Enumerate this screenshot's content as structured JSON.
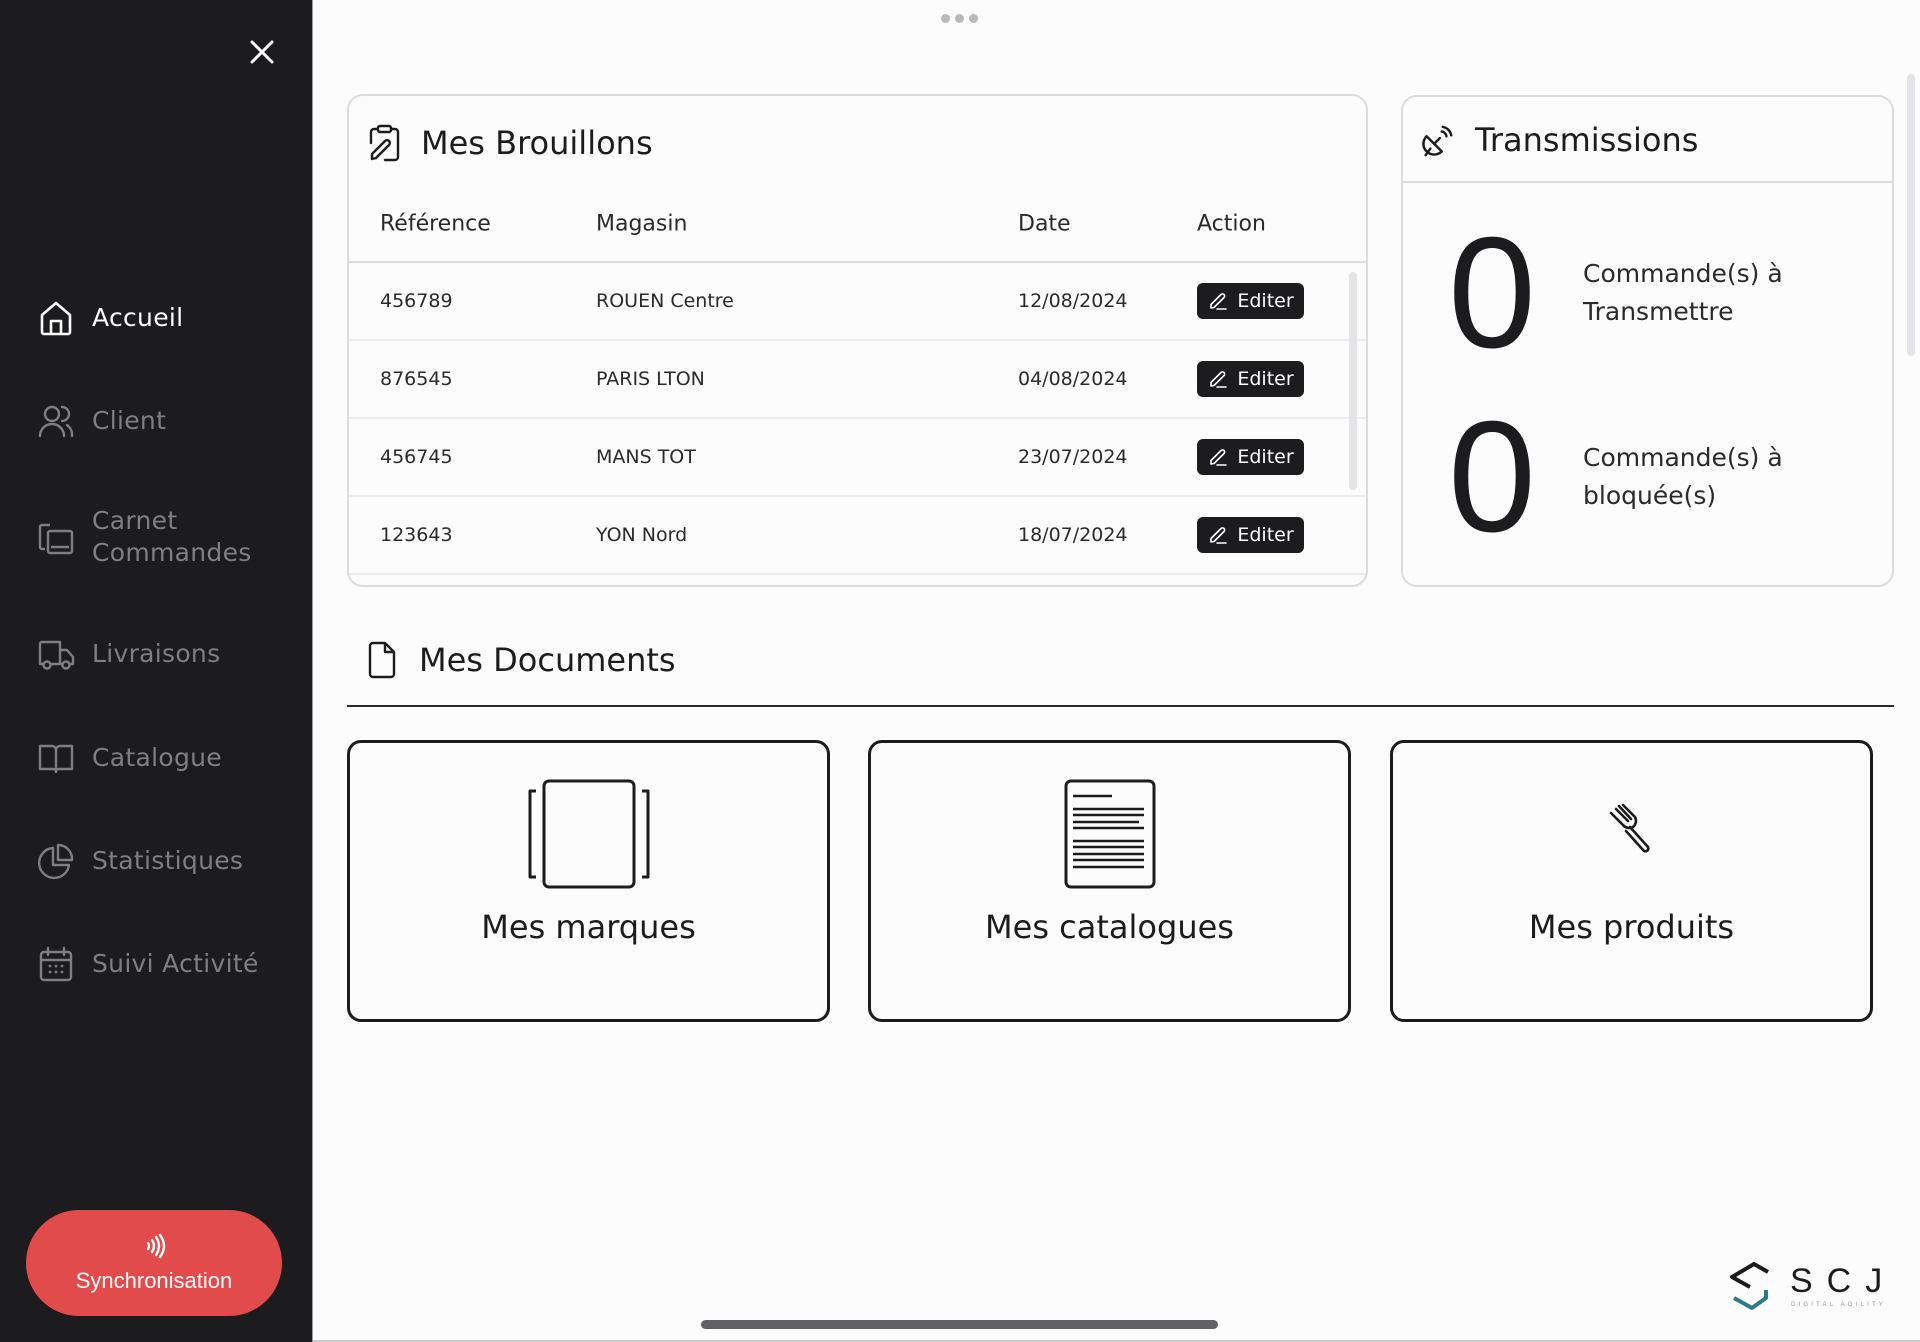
{
  "sidebar": {
    "close_icon": "close-icon",
    "items": [
      {
        "label": "Accueil",
        "icon": "home-icon",
        "active": true
      },
      {
        "label": "Client",
        "icon": "users-icon",
        "active": false
      },
      {
        "label": "Carnet Commandes",
        "icon": "order-book-icon",
        "active": false
      },
      {
        "label": "Livraisons",
        "icon": "truck-icon",
        "active": false
      },
      {
        "label": "Catalogue",
        "icon": "book-open-icon",
        "active": false
      },
      {
        "label": "Statistiques",
        "icon": "pie-chart-icon",
        "active": false
      },
      {
        "label": "Suivi Activité",
        "icon": "calendar-icon",
        "active": false
      }
    ],
    "sync_button": {
      "label": "Synchronisation",
      "icon": "contactless-icon",
      "color": "#e24b4b"
    }
  },
  "drafts": {
    "title": "Mes Brouillons",
    "icon": "clipboard-edit-icon",
    "columns": [
      "Référence",
      "Magasin",
      "Date",
      "Action"
    ],
    "rows": [
      {
        "reference": "456789",
        "store": "ROUEN Centre",
        "date": "12/08/2024",
        "action": "Editer"
      },
      {
        "reference": "876545",
        "store": "PARIS LTON",
        "date": "04/08/2024",
        "action": "Editer"
      },
      {
        "reference": "456745",
        "store": "MANS TOT",
        "date": "23/07/2024",
        "action": "Editer"
      },
      {
        "reference": "123643",
        "store": "YON Nord",
        "date": "18/07/2024",
        "action": "Editer"
      }
    ]
  },
  "transmissions": {
    "title": "Transmissions",
    "icon": "satellite-dish-icon",
    "stats": [
      {
        "value": "0",
        "label": "Commande(s) à Transmettre"
      },
      {
        "value": "0",
        "label": "Commande(s) à bloquée(s)"
      }
    ]
  },
  "documents": {
    "title": "Mes Documents",
    "icon": "document-icon",
    "cards": [
      {
        "label": "Mes marques",
        "icon": "pages-icon"
      },
      {
        "label": "Mes catalogues",
        "icon": "text-document-icon"
      },
      {
        "label": "Mes produits",
        "icon": "fork-icon"
      }
    ]
  },
  "logo": {
    "letters": "SCJ",
    "tagline": "DIGITAL AGILITY",
    "accent_color": "#2a7a8c"
  }
}
